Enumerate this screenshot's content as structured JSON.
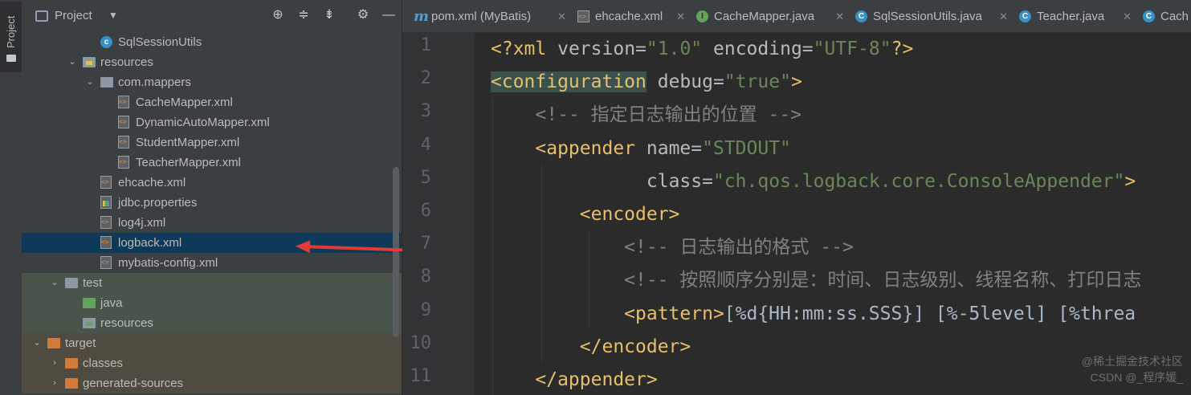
{
  "sidebar_stripe": {
    "label": "Project"
  },
  "project_panel": {
    "title": "Project",
    "tree": [
      {
        "label": "SqlSessionUtils",
        "icon": "class-icon",
        "depth": 3
      },
      {
        "label": "resources",
        "icon": "resources-folder-icon",
        "depth": 2,
        "arrow": "⌄"
      },
      {
        "label": "com.mappers",
        "icon": "folder-icon",
        "depth": 3,
        "arrow": "⌄"
      },
      {
        "label": "CacheMapper.xml",
        "icon": "xml-file-icon",
        "depth": 4
      },
      {
        "label": "DynamicAutoMapper.xml",
        "icon": "xml-file-icon",
        "depth": 4
      },
      {
        "label": "StudentMapper.xml",
        "icon": "xml-file-icon",
        "depth": 4
      },
      {
        "label": "TeacherMapper.xml",
        "icon": "xml-file-icon",
        "depth": 4
      },
      {
        "label": "ehcache.xml",
        "icon": "xml-file-icon",
        "depth": 3
      },
      {
        "label": "jdbc.properties",
        "icon": "properties-file-icon",
        "depth": 3
      },
      {
        "label": "log4j.xml",
        "icon": "xml-file-icon",
        "depth": 3
      },
      {
        "label": "logback.xml",
        "icon": "xml-file-icon",
        "depth": 3,
        "selected": true
      },
      {
        "label": "mybatis-config.xml",
        "icon": "xml-file-icon",
        "depth": 3
      },
      {
        "label": "test",
        "icon": "folder-icon",
        "depth": 1,
        "arrow": "⌄"
      },
      {
        "label": "java",
        "icon": "test-source-folder-icon",
        "depth": 2
      },
      {
        "label": "resources",
        "icon": "test-resources-folder-icon",
        "depth": 2
      },
      {
        "label": "target",
        "icon": "excluded-folder-icon",
        "depth": 0,
        "arrow": "⌄"
      },
      {
        "label": "classes",
        "icon": "excluded-folder-icon",
        "depth": 1,
        "arrow": "›"
      },
      {
        "label": "generated-sources",
        "icon": "excluded-folder-icon",
        "depth": 1,
        "arrow": "›"
      }
    ]
  },
  "editor_tabs": [
    {
      "label": "pom.xml (MyBatis)",
      "icon": "maven-icon"
    },
    {
      "label": "ehcache.xml",
      "icon": "xml-file-icon"
    },
    {
      "label": "CacheMapper.java",
      "icon": "interface-icon"
    },
    {
      "label": "SqlSessionUtils.java",
      "icon": "class-icon"
    },
    {
      "label": "Teacher.java",
      "icon": "class-icon"
    },
    {
      "label": "Cach",
      "icon": "class-icon"
    }
  ],
  "editor": {
    "line_numbers": [
      "1",
      "2",
      "3",
      "4",
      "5",
      "6",
      "7",
      "8",
      "9",
      "10",
      "11"
    ],
    "lines": [
      [
        [
          "t-tag",
          "<?xml"
        ],
        [
          "",
          " "
        ],
        [
          "t-attr",
          "version"
        ],
        [
          "",
          "="
        ],
        [
          "t-val",
          "\"1.0\""
        ],
        [
          "",
          " "
        ],
        [
          "t-attr",
          "encoding"
        ],
        [
          "",
          "="
        ],
        [
          "t-val",
          "\"UTF-8\""
        ],
        [
          "t-tag",
          "?>"
        ]
      ],
      [
        [
          "t-tag hl-tag",
          "<configuration"
        ],
        [
          "",
          " "
        ],
        [
          "t-attr",
          "debug"
        ],
        [
          "",
          "="
        ],
        [
          "t-val",
          "\"true\""
        ],
        [
          "t-tag",
          ">"
        ]
      ],
      [
        [
          "",
          "    "
        ],
        [
          "t-cmt",
          "<!-- 指定日志输出的位置 -->"
        ]
      ],
      [
        [
          "",
          "    "
        ],
        [
          "t-tag",
          "<appender"
        ],
        [
          "",
          " "
        ],
        [
          "t-attr",
          "name"
        ],
        [
          "",
          "="
        ],
        [
          "t-val",
          "\"STDOUT\""
        ]
      ],
      [
        [
          "",
          "              "
        ],
        [
          "t-attr",
          "class"
        ],
        [
          "",
          "="
        ],
        [
          "t-val",
          "\"ch.qos.logback.core.ConsoleAppender\""
        ],
        [
          "t-tag",
          ">"
        ]
      ],
      [
        [
          "",
          "        "
        ],
        [
          "t-tag",
          "<encoder>"
        ]
      ],
      [
        [
          "",
          "            "
        ],
        [
          "t-cmt",
          "<!-- 日志输出的格式 -->"
        ]
      ],
      [
        [
          "",
          "            "
        ],
        [
          "t-cmt",
          "<!-- 按照顺序分别是：时间、日志级别、线程名称、打印日志"
        ]
      ],
      [
        [
          "",
          "            "
        ],
        [
          "t-tag",
          "<pattern>"
        ],
        [
          "",
          "[%d{HH:mm:ss.SSS}] [%-5level] [%threa"
        ]
      ],
      [
        [
          "",
          "        "
        ],
        [
          "t-tag",
          "</encoder>"
        ]
      ],
      [
        [
          "",
          "    "
        ],
        [
          "t-tag",
          "</appender>"
        ]
      ]
    ]
  },
  "watermark": {
    "line1": "@稀土掘金技术社区",
    "line2": "CSDN @_程序媛_"
  },
  "colors": {
    "selection": "#0d3a58",
    "arrow_annotation": "#e33a35"
  }
}
